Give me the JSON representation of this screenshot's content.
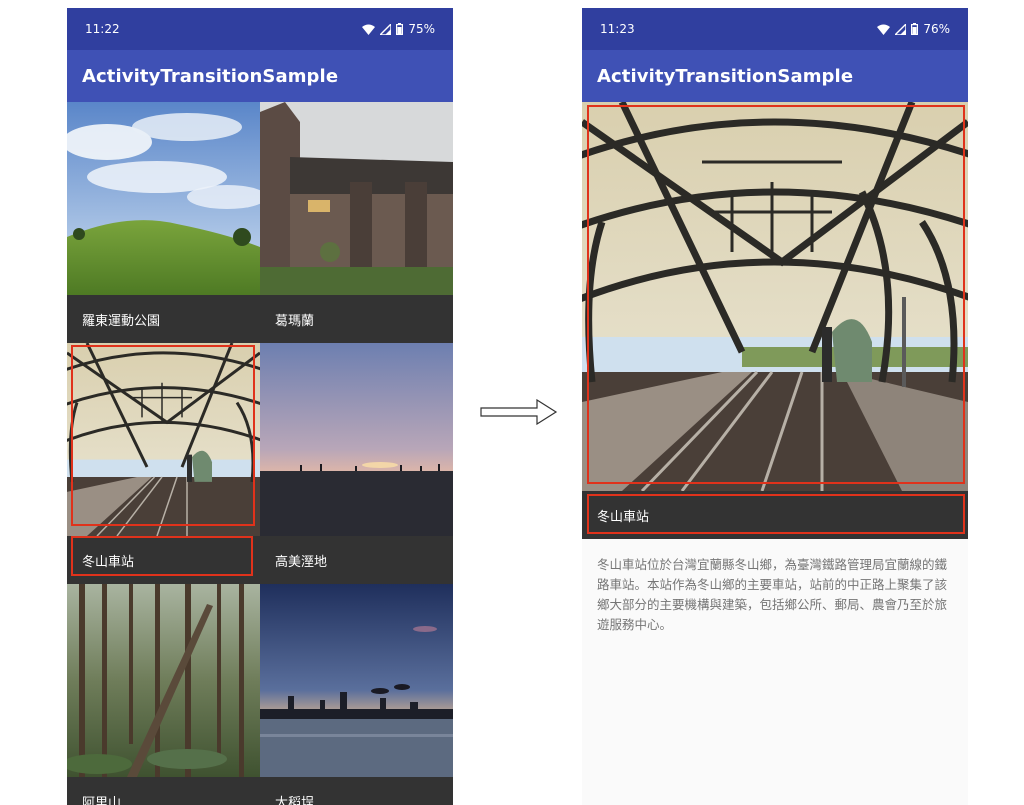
{
  "left_screen": {
    "status": {
      "time": "11:22",
      "battery": "75%"
    },
    "app_title": "ActivityTransitionSample",
    "items": [
      {
        "caption": "羅東運動公園",
        "image": "grassy-hill-photo"
      },
      {
        "caption": "葛瑪蘭",
        "image": "brick-building-photo"
      },
      {
        "caption": "冬山車站",
        "image": "train-station-photo"
      },
      {
        "caption": "高美溼地",
        "image": "wetland-sunset-photo"
      },
      {
        "caption": "阿里山",
        "image": "forest-photo"
      },
      {
        "caption": "大稻埕",
        "image": "city-skyline-dusk-photo"
      }
    ]
  },
  "right_screen": {
    "status": {
      "time": "11:23",
      "battery": "76%"
    },
    "app_title": "ActivityTransitionSample",
    "detail": {
      "image": "train-station-photo",
      "caption": "冬山車站",
      "description": "冬山車站位於台灣宜蘭縣冬山鄉，為臺灣鐵路管理局宜蘭線的鐵路車站。本站作為冬山鄉的主要車站，站前的中正路上聚集了該鄉大部分的主要機構與建築，包括鄉公所、郵局、農會乃至於旅遊服務中心。"
    }
  },
  "annotations": {
    "highlight_color": "#e0321b",
    "arrow": "right-arrow-icon"
  },
  "colors": {
    "status_bar": "#303f9f",
    "app_bar": "#3f51b5",
    "caption_bg": "#333333"
  }
}
